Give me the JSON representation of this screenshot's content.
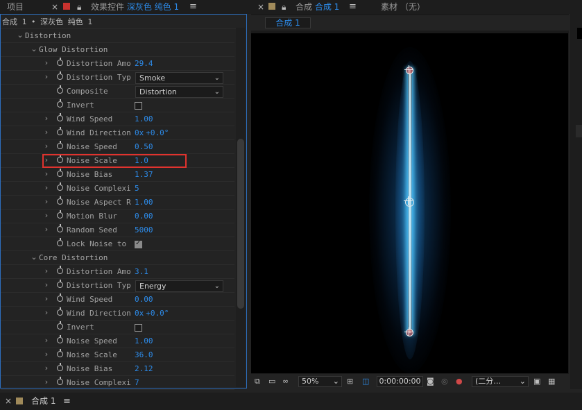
{
  "tabs": {
    "project": "项目",
    "effect_controls_prefix": "效果控件",
    "effect_controls_layer": "深灰色 纯色 1",
    "composition_prefix": "合成",
    "composition_name": "合成 1",
    "footage": "素材 （无）"
  },
  "breadcrumb": "合成 1 • 深灰色 纯色 1",
  "rows": [
    {
      "label": "Distortion",
      "type": "group",
      "indent": 0
    },
    {
      "label": "Glow Distortion",
      "type": "group",
      "indent": 1
    },
    {
      "label": "Distortion Amou",
      "type": "num",
      "value": "29.4",
      "twirl": true
    },
    {
      "label": "Distortion Type",
      "type": "dropdown",
      "value": "Smoke",
      "twirl": true
    },
    {
      "label": "Composite",
      "type": "dropdown",
      "value": "Distortion",
      "twirl": false
    },
    {
      "label": "Invert",
      "type": "checkbox",
      "checked": false,
      "twirl": false
    },
    {
      "label": "Wind Speed",
      "type": "num",
      "value": "1.00",
      "twirl": true
    },
    {
      "label": "Wind Direction",
      "type": "angle",
      "value": "0x",
      "value2": "+0.0°",
      "twirl": true
    },
    {
      "label": "Noise Speed",
      "type": "num",
      "value": "0.50",
      "twirl": true
    },
    {
      "label": "Noise Scale",
      "type": "num",
      "value": "1.0",
      "twirl": true
    },
    {
      "label": "Noise Bias",
      "type": "num",
      "value": "1.37",
      "twirl": true
    },
    {
      "label": "Noise Complexit",
      "type": "num",
      "value": "5",
      "twirl": true
    },
    {
      "label": "Noise Aspect Ra",
      "type": "num",
      "value": "1.00",
      "twirl": true
    },
    {
      "label": "Motion Blur",
      "type": "num",
      "value": "0.00",
      "twirl": true
    },
    {
      "label": "Random Seed",
      "type": "num",
      "value": "5000",
      "twirl": true
    },
    {
      "label": "Lock Noise to S",
      "type": "checkbox",
      "checked": true,
      "twirl": false
    },
    {
      "label": "Core Distortion",
      "type": "group",
      "indent": 1
    },
    {
      "label": "Distortion Amou",
      "type": "num",
      "value": "3.1",
      "twirl": true
    },
    {
      "label": "Distortion Type",
      "type": "dropdown",
      "value": "Energy",
      "twirl": true
    },
    {
      "label": "Wind Speed",
      "type": "num",
      "value": "0.00",
      "twirl": true
    },
    {
      "label": "Wind Direction",
      "type": "angle",
      "value": "0x",
      "value2": "+0.0°",
      "twirl": true
    },
    {
      "label": "Invert",
      "type": "checkbox",
      "checked": false,
      "twirl": false
    },
    {
      "label": "Noise Speed",
      "type": "num",
      "value": "1.00",
      "twirl": true
    },
    {
      "label": "Noise Scale",
      "type": "num",
      "value": "36.0",
      "twirl": true
    },
    {
      "label": "Noise Bias",
      "type": "num",
      "value": "2.12",
      "twirl": true
    },
    {
      "label": "Noise Complexit",
      "type": "num",
      "value": "7",
      "twirl": true
    }
  ],
  "viewer_bar": {
    "zoom": "50%",
    "timecode": "0:00:00:00",
    "resolution": "(二分…"
  },
  "timeline_tab": "合成 1",
  "colors": {
    "accent": "#2d8ceb",
    "highlight_box": "#e0332e",
    "beam": "#5fd0ff"
  }
}
